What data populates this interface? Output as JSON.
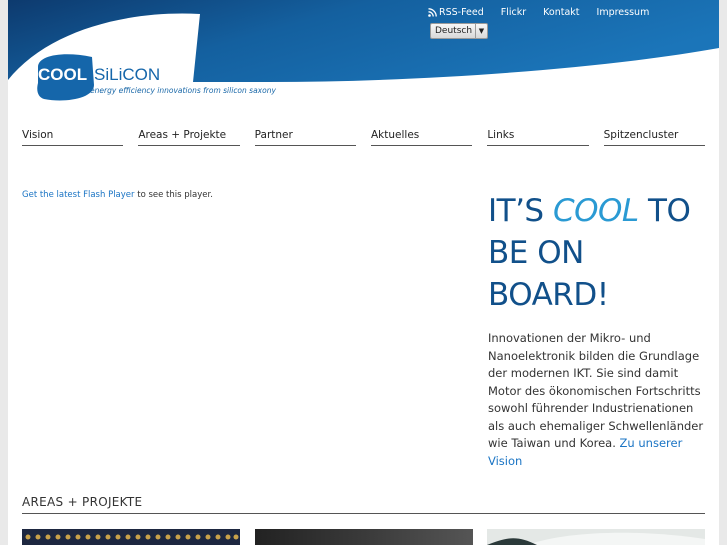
{
  "topnav": {
    "rss": "RSS-Feed",
    "flickr": "Flickr",
    "kontakt": "Kontakt",
    "impressum": "Impressum"
  },
  "language": {
    "selected": "Deutsch"
  },
  "logo": {
    "cool": "COOL",
    "silicon": "SiLiCON",
    "tagline": "energy efficiency innovations from silicon saxony"
  },
  "mainnav": [
    "Vision",
    "Areas + Projekte",
    "Partner",
    "Aktuelles",
    "Links",
    "Spitzencluster"
  ],
  "flash": {
    "link": "Get the latest Flash Player",
    "suffix": " to see this player."
  },
  "hero": {
    "line1a": "IT’S ",
    "cool": "COOL",
    "line1b": " TO",
    "line2": "BE ON",
    "line3": "BOARD!",
    "text": "Innovationen der Mikro- und Nanoelektronik bilden die Grundlage der modernen IKT. Sie sind damit Motor des ökonomischen Fortschritts sowohl führender Industrienationen als auch ehemaliger Schwellenländer wie Taiwan und Korea. ",
    "link": "Zu unserer Vision"
  },
  "section": {
    "title": "AREAS + PROJEKTE"
  },
  "colors": {
    "brand_blue": "#11508a",
    "accent_blue": "#2a9ad3",
    "link_blue": "#1a74c4"
  }
}
